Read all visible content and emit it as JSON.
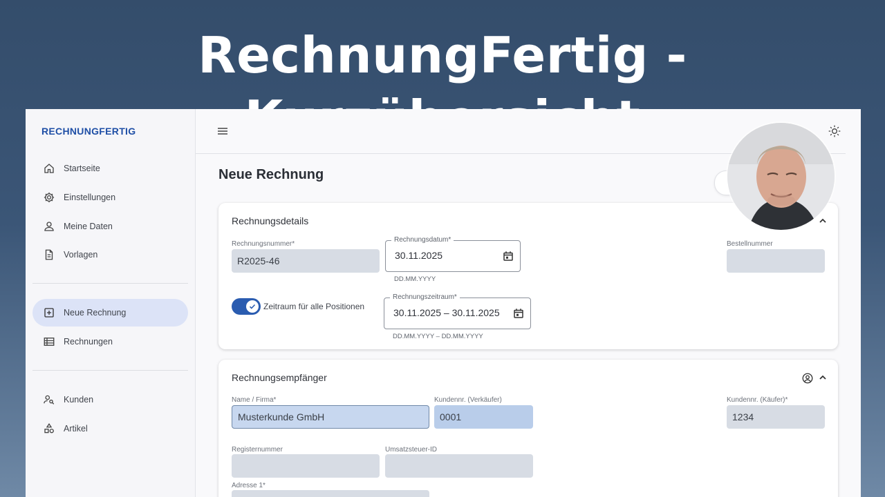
{
  "banner": {
    "title": "RechnungFertig - Kurzübersicht"
  },
  "sidebar": {
    "brand": "RECHNUNGFERTIG",
    "items": [
      {
        "label": "Startseite",
        "icon": "home-icon"
      },
      {
        "label": "Einstellungen",
        "icon": "gear-icon"
      },
      {
        "label": "Meine Daten",
        "icon": "person-icon"
      },
      {
        "label": "Vorlagen",
        "icon": "document-icon"
      },
      {
        "label": "Neue Rechnung",
        "icon": "add-box-icon",
        "active": true
      },
      {
        "label": "Rechnungen",
        "icon": "table-icon"
      },
      {
        "label": "Kunden",
        "icon": "person-search-icon"
      },
      {
        "label": "Artikel",
        "icon": "category-icon"
      }
    ]
  },
  "header": {
    "page_title": "Neue Rechnung"
  },
  "details": {
    "title": "Rechnungsdetails",
    "invoice_number": {
      "label": "Rechnungsnummer*",
      "value": "R2025-46"
    },
    "invoice_date": {
      "label": "Rechnungsdatum*",
      "value": "30.11.2025",
      "hint": "DD.MM.YYYY"
    },
    "order_number": {
      "label": "Bestellnummer",
      "value": ""
    },
    "period_toggle": {
      "label": "Zeitraum für alle Positionen",
      "on": true
    },
    "invoice_period": {
      "label": "Rechnungszeitraum*",
      "value": "30.11.2025 – 30.11.2025",
      "hint": "DD.MM.YYYY – DD.MM.YYYY"
    }
  },
  "recipient": {
    "title": "Rechnungsempfänger",
    "name": {
      "label": "Name / Firma*",
      "value": "Musterkunde GmbH"
    },
    "seller_customer_no": {
      "label": "Kundennr. (Verkäufer)",
      "value": "0001"
    },
    "buyer_customer_no": {
      "label": "Kundennr. (Käufer)*",
      "value": "1234"
    },
    "register_no": {
      "label": "Registernummer",
      "value": ""
    },
    "vat_id": {
      "label": "Umsatzsteuer-ID",
      "value": ""
    },
    "address1": {
      "label": "Adresse 1*",
      "value": ""
    }
  },
  "colors": {
    "accent": "#2a5cb0",
    "brand": "#1f4fa6",
    "active_nav": "#dce3f7",
    "field_fill": "#d7dce4"
  }
}
